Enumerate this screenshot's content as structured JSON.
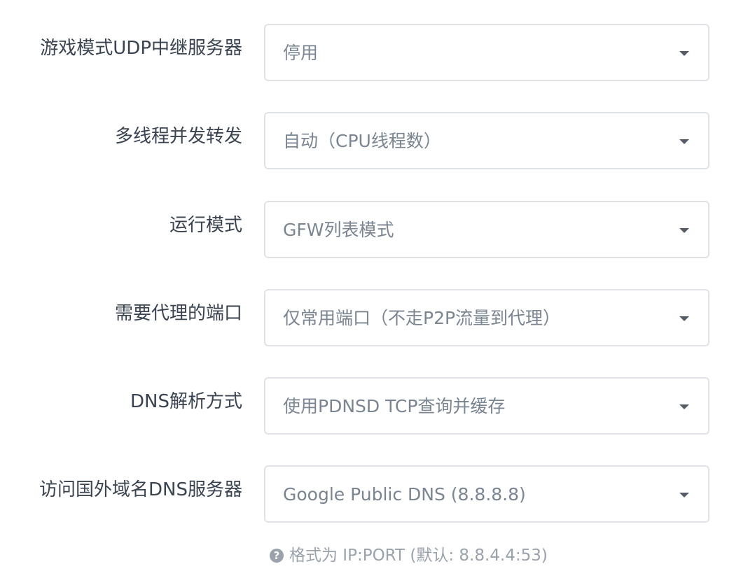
{
  "settings": [
    {
      "label": "游戏模式UDP中继服务器",
      "value": "停用"
    },
    {
      "label": "多线程并发转发",
      "value": "自动（CPU线程数）"
    },
    {
      "label": "运行模式",
      "value": "GFW列表模式"
    },
    {
      "label": "需要代理的端口",
      "value": "仅常用端口（不走P2P流量到代理）"
    },
    {
      "label": "DNS解析方式",
      "value": "使用PDNSD TCP查询并缓存"
    },
    {
      "label": "访问国外域名DNS服务器",
      "value": "Google Public DNS (8.8.8.8)"
    }
  ],
  "help": {
    "icon": "?",
    "text": "格式为 IP:PORT (默认: 8.8.4.4:53)"
  }
}
